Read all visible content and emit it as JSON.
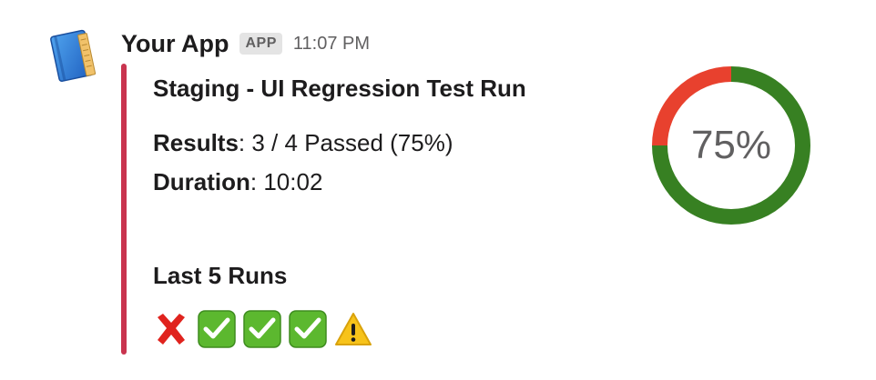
{
  "message": {
    "sender": "Your App",
    "badge": "APP",
    "time": "11:07 PM"
  },
  "attachment": {
    "accent_color": "#c9344f",
    "title": "Staging - UI Regression Test Run",
    "results_label": "Results",
    "results_value": "3 / 4 Passed (75%)",
    "duration_label": "Duration",
    "duration_value": "10:02",
    "last_runs_label": "Last 5 Runs",
    "last_runs": [
      "fail-x-icon",
      "pass-check-icon",
      "pass-check-icon",
      "pass-check-icon",
      "warning-icon"
    ]
  },
  "chart_data": {
    "type": "pie",
    "label": "75%",
    "slices": [
      {
        "value": 75,
        "color": "#378022"
      },
      {
        "value": 25,
        "color": "#e8412e"
      }
    ]
  }
}
